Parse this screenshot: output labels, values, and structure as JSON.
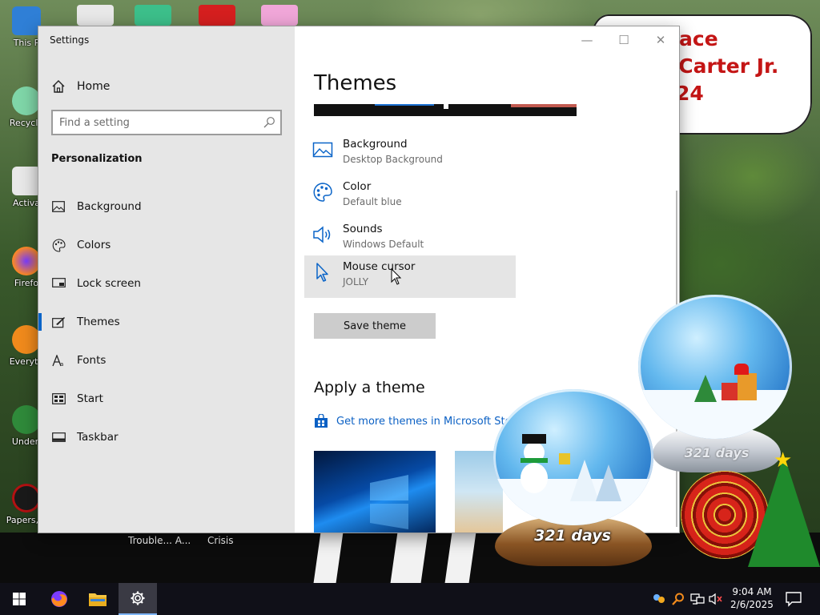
{
  "desktop": {
    "icons": [
      {
        "label": "This P"
      },
      {
        "label": "Recycle"
      },
      {
        "label": "Activa"
      },
      {
        "label": "Firefo"
      },
      {
        "label": "Everyth"
      },
      {
        "label": "Underl"
      },
      {
        "label": "Papers, P"
      }
    ],
    "speech_lines": [
      "ace",
      "l Carter Jr.",
      "24"
    ],
    "taskbar_labels": [
      "Trouble... A...",
      "Crisis"
    ]
  },
  "settings": {
    "window_title": "Settings",
    "controls": {
      "minimize": "—",
      "maximize": "☐",
      "close": "✕"
    },
    "sidebar": {
      "home_label": "Home",
      "search_placeholder": "Find a setting",
      "section_title": "Personalization",
      "items": [
        {
          "label": "Background",
          "icon": "image-icon"
        },
        {
          "label": "Colors",
          "icon": "palette-icon"
        },
        {
          "label": "Lock screen",
          "icon": "lock-screen-icon"
        },
        {
          "label": "Themes",
          "icon": "brush-icon",
          "active": true
        },
        {
          "label": "Fonts",
          "icon": "font-icon"
        },
        {
          "label": "Start",
          "icon": "start-icon"
        },
        {
          "label": "Taskbar",
          "icon": "taskbar-icon"
        }
      ]
    },
    "content": {
      "title": "Themes",
      "properties": [
        {
          "name": "Background",
          "value": "Desktop Background",
          "icon": "image-icon"
        },
        {
          "name": "Color",
          "value": "Default blue",
          "icon": "palette-icon"
        },
        {
          "name": "Sounds",
          "value": "Windows Default",
          "icon": "speaker-icon"
        },
        {
          "name": "Mouse cursor",
          "value": "JOLLY",
          "icon": "cursor-icon"
        }
      ],
      "save_button": "Save theme",
      "apply_title": "Apply a theme",
      "store_link": "Get more themes in Microsoft Stor"
    }
  },
  "widgets": {
    "globe_front_days": "321 days",
    "globe_back_days": "321 days"
  },
  "taskbar": {
    "time": "9:04 AM",
    "date": "2/6/2025"
  },
  "colors": {
    "accent": "#0a64c8",
    "link": "#0b60c4",
    "sidebar_bg": "#e6e6e6",
    "taskbar_bg": "#101018"
  }
}
